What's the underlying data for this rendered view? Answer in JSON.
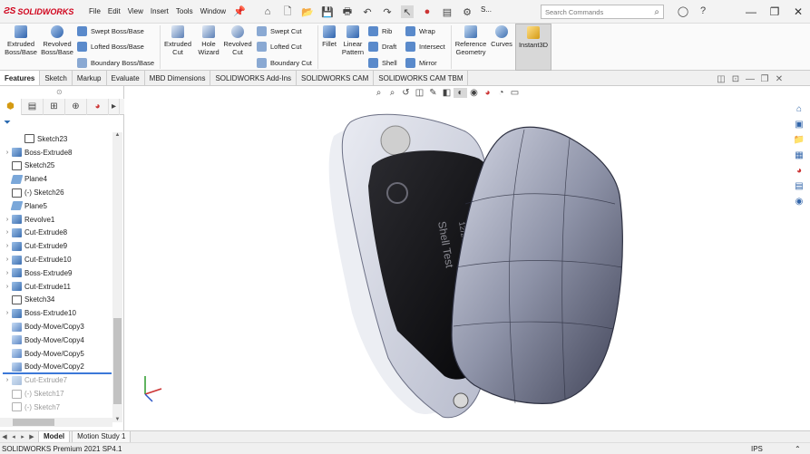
{
  "app": {
    "brand": "SOLIDWORKS",
    "brand_mark": "ƧS"
  },
  "menus": [
    "File",
    "Edit",
    "View",
    "Insert",
    "Tools",
    "Window"
  ],
  "title_short": "S...",
  "search": {
    "placeholder": "Search Commands"
  },
  "commands": {
    "extruded_boss": "Extruded Boss/Base",
    "revolved_boss": "Revolved Boss/Base",
    "swept_boss": "Swept Boss/Base",
    "lofted_boss": "Lofted Boss/Base",
    "boundary_boss": "Boundary Boss/Base",
    "extruded_cut": "Extruded Cut",
    "hole_wizard": "Hole Wizard",
    "revolved_cut": "Revolved Cut",
    "swept_cut": "Swept Cut",
    "lofted_cut": "Lofted Cut",
    "boundary_cut": "Boundary Cut",
    "fillet": "Fillet",
    "linear_pattern": "Linear Pattern",
    "rib": "Rib",
    "draft": "Draft",
    "shell": "Shell",
    "wrap": "Wrap",
    "intersect": "Intersect",
    "mirror": "Mirror",
    "reference_geometry": "Reference Geometry",
    "curves": "Curves",
    "instant3d": "Instant3D"
  },
  "tabs": [
    "Features",
    "Sketch",
    "Markup",
    "Evaluate",
    "MBD Dimensions",
    "SOLIDWORKS Add-Ins",
    "SOLIDWORKS CAM",
    "SOLIDWORKS CAM TBM"
  ],
  "tree": [
    {
      "label": "Sketch23",
      "icon": "sketch",
      "indent": 1
    },
    {
      "label": "Boss-Extrude8",
      "icon": "feat",
      "expand": true
    },
    {
      "label": "Sketch25",
      "icon": "sketch"
    },
    {
      "label": "Plane4",
      "icon": "plane"
    },
    {
      "label": "(-) Sketch26",
      "icon": "sketch"
    },
    {
      "label": "Plane5",
      "icon": "plane"
    },
    {
      "label": "Revolve1",
      "icon": "feat",
      "expand": true
    },
    {
      "label": "Cut-Extrude8",
      "icon": "feat",
      "expand": true
    },
    {
      "label": "Cut-Extrude9",
      "icon": "feat",
      "expand": true
    },
    {
      "label": "Cut-Extrude10",
      "icon": "feat",
      "expand": true
    },
    {
      "label": "Boss-Extrude9",
      "icon": "feat",
      "expand": true
    },
    {
      "label": "Cut-Extrude11",
      "icon": "feat",
      "expand": true
    },
    {
      "label": "Sketch34",
      "icon": "sketch"
    },
    {
      "label": "Boss-Extrude10",
      "icon": "feat",
      "expand": true
    },
    {
      "label": "Body-Move/Copy3",
      "icon": "move"
    },
    {
      "label": "Body-Move/Copy4",
      "icon": "move"
    },
    {
      "label": "Body-Move/Copy5",
      "icon": "move"
    },
    {
      "label": "Body-Move/Copy2",
      "icon": "move"
    },
    {
      "label": "Cut-Extrude7",
      "icon": "feat",
      "expand": true,
      "suppressed": true
    },
    {
      "label": "(-) Sketch17",
      "icon": "sketch",
      "suppressed": true
    },
    {
      "label": "(-) Sketch7",
      "icon": "sketch",
      "suppressed": true
    }
  ],
  "model_label": {
    "line1": "Shell Test",
    "line2": "12/20"
  },
  "bottom_tabs": [
    "Model",
    "Motion Study 1"
  ],
  "status": {
    "text": "SOLIDWORKS Premium 2021 SP4.1",
    "units": "IPS"
  },
  "colors": {
    "accent": "#3b78d8",
    "brand": "#d0021b",
    "shell": "#8e93a8"
  }
}
